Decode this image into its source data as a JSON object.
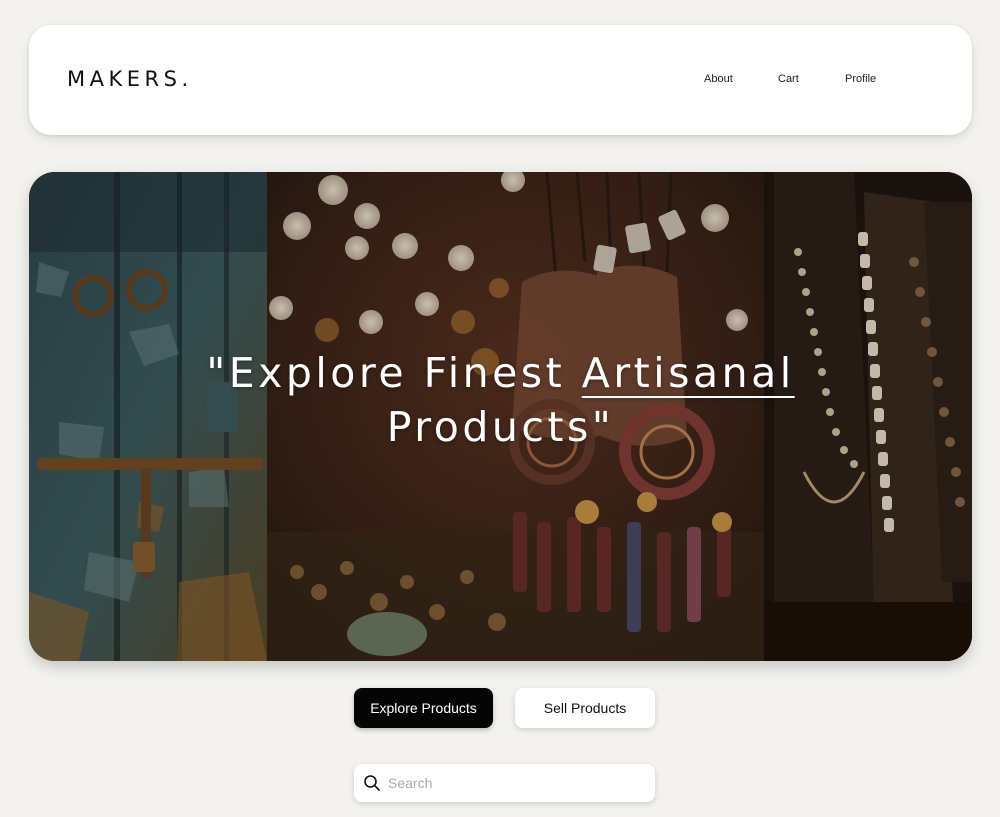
{
  "header": {
    "logo": "MAKERS.",
    "nav": {
      "about": "About",
      "cart": "Cart",
      "profile": "Profile"
    }
  },
  "hero": {
    "title_before": "\"Explore Finest ",
    "title_underlined": "Artisanal",
    "title_after": " Products\"",
    "images": [
      "weathered-blue-door-image",
      "hanging-dreamcatchers-image",
      "bead-necklaces-image"
    ]
  },
  "actions": {
    "explore_label": "Explore Products",
    "sell_label": "Sell Products"
  },
  "search": {
    "placeholder": "Search",
    "value": ""
  },
  "colors": {
    "background": "#f3f2ee",
    "primary_button": "#050505",
    "secondary_button": "#ffffff"
  }
}
